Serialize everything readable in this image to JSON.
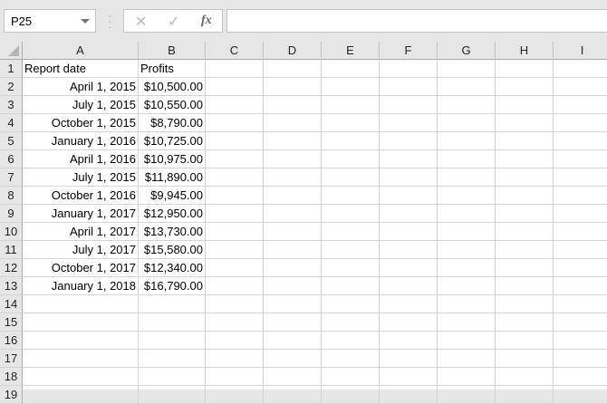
{
  "name_box": "P25",
  "formula_bar": {
    "cancel_icon": "✕",
    "enter_icon": "✓",
    "fx_label": "fx",
    "value": ""
  },
  "columns": [
    "A",
    "B",
    "C",
    "D",
    "E",
    "F",
    "G",
    "H",
    "I"
  ],
  "rows": [
    [
      "Report date",
      "Profits"
    ],
    [
      "April 1, 2015",
      "$10,500.00"
    ],
    [
      "July 1, 2015",
      "$10,550.00"
    ],
    [
      "October 1, 2015",
      "$8,790.00"
    ],
    [
      "January 1, 2016",
      "$10,725.00"
    ],
    [
      "April 1, 2016",
      "$10,975.00"
    ],
    [
      "July 1, 2015",
      "$11,890.00"
    ],
    [
      "October 1, 2016",
      "$9,945.00"
    ],
    [
      "January 1, 2017",
      "$12,950.00"
    ],
    [
      "April 1, 2017",
      "$13,730.00"
    ],
    [
      "July 1, 2017",
      "$15,580.00"
    ],
    [
      "October 1, 2017",
      "$12,340.00"
    ],
    [
      "January 1, 2018",
      "$16,790.00"
    ],
    [
      "",
      ""
    ],
    [
      "",
      ""
    ],
    [
      "",
      ""
    ],
    [
      "",
      ""
    ],
    [
      "",
      ""
    ]
  ],
  "row_numbers": [
    "1",
    "2",
    "3",
    "4",
    "5",
    "6",
    "7",
    "8",
    "9",
    "10",
    "11",
    "12",
    "13",
    "14",
    "15",
    "16",
    "17",
    "18",
    "19"
  ]
}
